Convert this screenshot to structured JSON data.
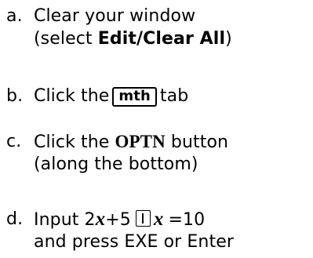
{
  "steps": [
    {
      "marker": "a.",
      "line1": "Clear your window",
      "line2_prefix": "(select ",
      "line2_bold": "Edit/Clear All",
      "line2_suffix": ")"
    },
    {
      "marker": "b.",
      "prefix": "Click the",
      "key": "mth",
      "suffix": "tab"
    },
    {
      "marker": "c.",
      "prefix": "Click the ",
      "bold": "OPTN",
      "suffix": " button",
      "line2": "(along the bottom)"
    },
    {
      "marker": "d.",
      "input_label": "Input 2",
      "var": "x",
      "plus_five": "+5",
      "key_icon": "vertical-bar-key-icon",
      "equals_ten": "=10",
      "line2": "and press EXE or Enter"
    }
  ]
}
